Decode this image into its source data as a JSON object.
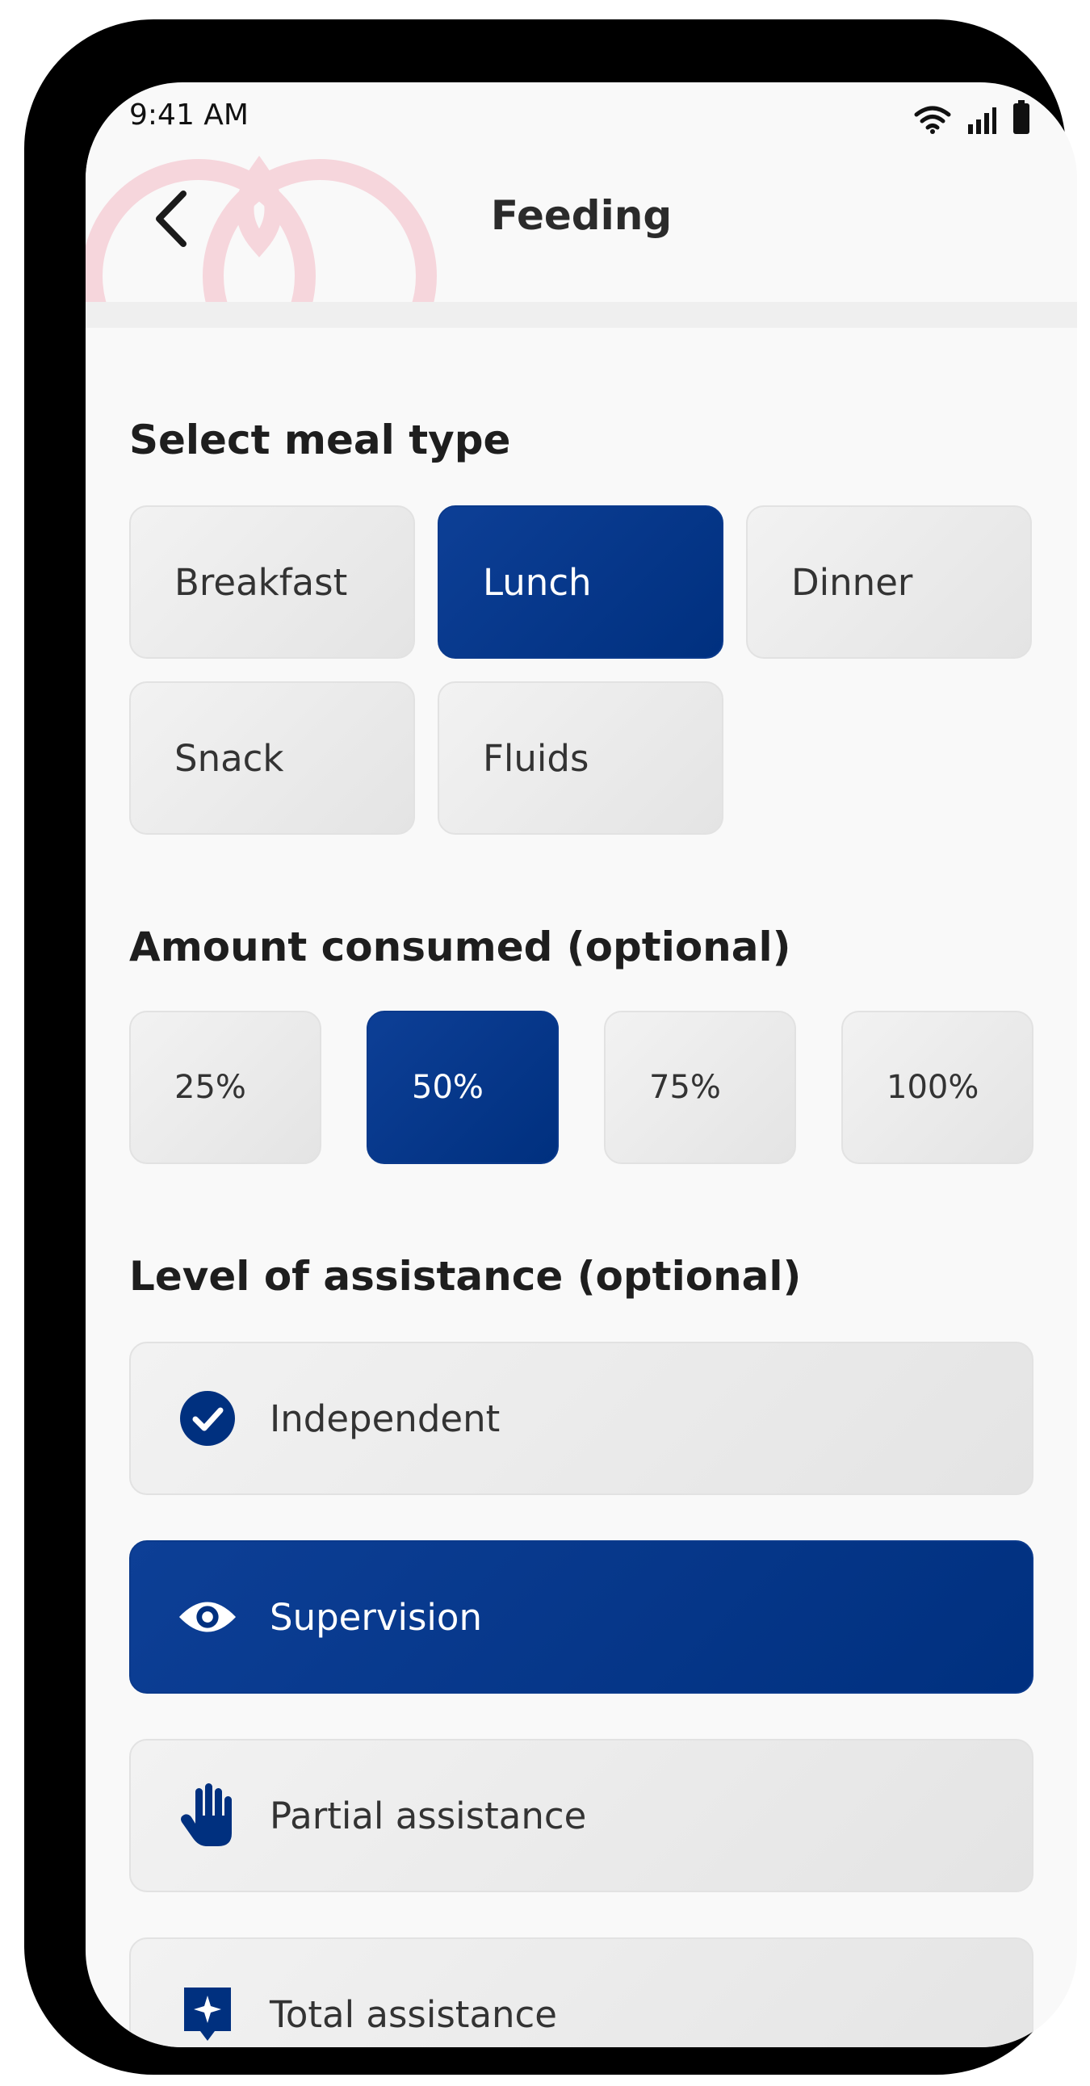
{
  "status_bar": {
    "time": "9:41 AM",
    "icons": [
      "wifi-icon",
      "signal-icon",
      "battery-icon"
    ]
  },
  "header": {
    "title": "Feeding",
    "back_icon": "chevron-left-icon"
  },
  "meal_type": {
    "title": "Select meal type",
    "options": [
      "Breakfast",
      "Lunch",
      "Dinner",
      "Snack",
      "Fluids"
    ],
    "selected": "Lunch"
  },
  "amount": {
    "title": "Amount consumed (optional)",
    "options": [
      "25%",
      "50%",
      "75%",
      "100%"
    ],
    "selected": "50%"
  },
  "assistance": {
    "title": "Level of assistance (optional)",
    "options": [
      {
        "label": "Independent",
        "icon": "check-circle-icon"
      },
      {
        "label": "Supervision",
        "icon": "eye-icon"
      },
      {
        "label": "Partial assistance",
        "icon": "hand-icon"
      },
      {
        "label": "Total assistance",
        "icon": "sparkle-badge-icon"
      }
    ],
    "selected": "Supervision"
  },
  "colors": {
    "accent": "#00307f",
    "chip_bg": "#ececec",
    "text": "#333333",
    "watermark": "#f6d6dc"
  }
}
